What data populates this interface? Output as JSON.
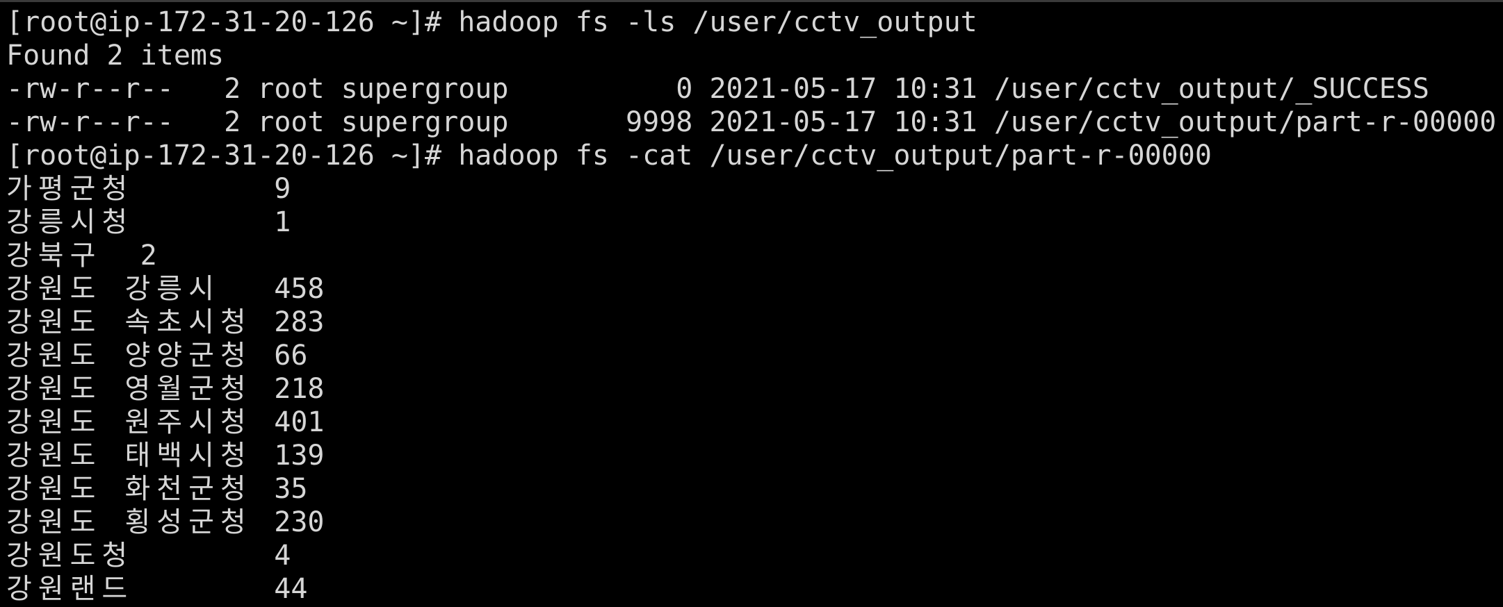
{
  "terminal": {
    "lines": [
      "[root@ip-172-31-20-126 ~]# hadoop fs -ls /user/cctv_output",
      "Found 2 items",
      "-rw-r--r--   2 root supergroup          0 2021-05-17 10:31 /user/cctv_output/_SUCCESS",
      "-rw-r--r--   2 root supergroup       9998 2021-05-17 10:31 /user/cctv_output/part-r-00000",
      "[root@ip-172-31-20-126 ~]# hadoop fs -cat /user/cctv_output/part-r-00000"
    ],
    "rows": [
      {
        "name": "가평군청",
        "value": "9"
      },
      {
        "name": "강릉시청",
        "value": "1"
      },
      {
        "name": "강북구",
        "value": "2"
      },
      {
        "name": "강원도 강릉시",
        "value": "458"
      },
      {
        "name": "강원도 속초시청",
        "value": "283"
      },
      {
        "name": "강원도 양양군청",
        "value": "66"
      },
      {
        "name": "강원도 영월군청",
        "value": "218"
      },
      {
        "name": "강원도 원주시청",
        "value": "401"
      },
      {
        "name": "강원도 태백시청",
        "value": "139"
      },
      {
        "name": "강원도 화천군청",
        "value": "35"
      },
      {
        "name": "강원도 횡성군청",
        "value": "230"
      },
      {
        "name": "강원도청",
        "value": "4"
      },
      {
        "name": "강원랜드",
        "value": "44"
      }
    ]
  }
}
